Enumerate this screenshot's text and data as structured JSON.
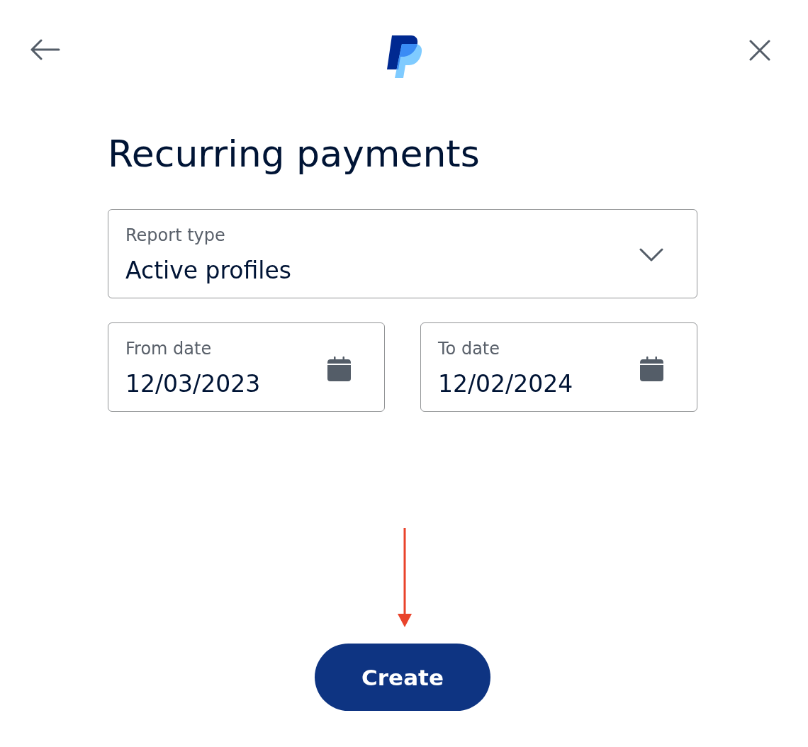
{
  "title": "Recurring payments",
  "report_type": {
    "label": "Report type",
    "value": "Active profiles"
  },
  "date_range": [
    {
      "label": "From date",
      "value": "12/03/2023"
    },
    {
      "label": "To date",
      "value": "12/02/2024"
    }
  ],
  "create_button": {
    "label": "Create"
  }
}
